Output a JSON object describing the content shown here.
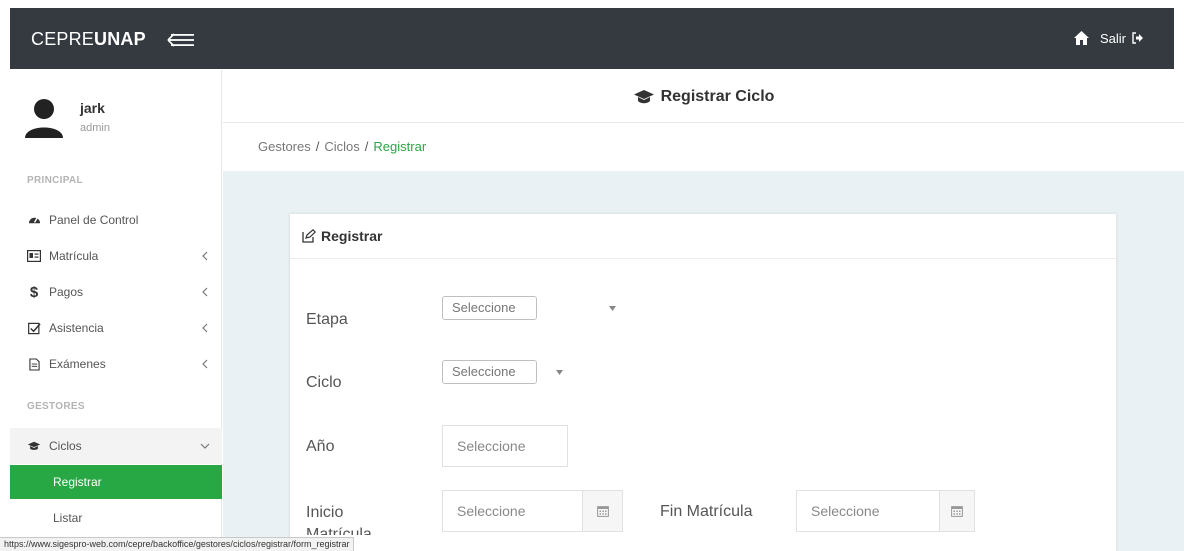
{
  "brand": {
    "prefix": "CEPRE",
    "bold": "UNAP"
  },
  "topnav": {
    "exit_label": "Salir"
  },
  "user": {
    "name": "jark",
    "role": "admin"
  },
  "sidebar": {
    "principal_label": "PRINCIPAL",
    "gestores_label": "GESTORES",
    "items": [
      {
        "label": "Panel de Control",
        "icon": "dashboard-icon"
      },
      {
        "label": "Matrícula",
        "icon": "id-card-icon"
      },
      {
        "label": "Pagos",
        "icon": "dollar-icon"
      },
      {
        "label": "Asistencia",
        "icon": "checkbox-icon"
      },
      {
        "label": "Exámenes",
        "icon": "document-icon"
      }
    ],
    "ciclos_label": "Ciclos",
    "subitems": [
      {
        "label": "Registrar"
      },
      {
        "label": "Listar"
      }
    ]
  },
  "page": {
    "title": "Registrar Ciclo",
    "breadcrumb": [
      "Gestores",
      "Ciclos",
      "Registrar"
    ]
  },
  "card": {
    "title": "Registrar",
    "fields": {
      "etapa_label": "Etapa",
      "etapa_value": "Seleccione",
      "ciclo_label": "Ciclo",
      "ciclo_value": "Seleccione",
      "anio_label": "Año",
      "anio_placeholder": "Seleccione",
      "inicio_label_line1": "Inicio",
      "inicio_label_line2": "Matrícula",
      "inicio_placeholder": "Seleccione",
      "fin_label": "Fin Matrícula",
      "fin_placeholder": "Seleccione"
    }
  },
  "status_url": "https://www.sigespro-web.com/cepre/backoffice/gestores/ciclos/registrar/form_registrar",
  "colors": {
    "topbar": "#343a40",
    "accent": "#28a745",
    "content_bg": "#e9f1f4"
  }
}
